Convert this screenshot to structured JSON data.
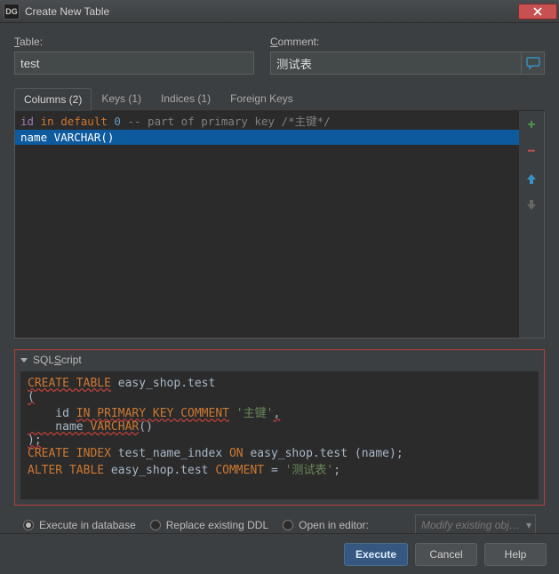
{
  "window": {
    "title": "Create New Table"
  },
  "labels": {
    "table": "Table:",
    "table_u": "T",
    "comment": "Comment:",
    "comment_u": "C",
    "sql_header": "SQL Script",
    "sql_u": "S"
  },
  "fields": {
    "table_value": "test",
    "comment_value": "测试表"
  },
  "tabs": {
    "columns": "Columns (2)",
    "keys": "Keys (1)",
    "indices": "Indices (1)",
    "fkeys": "Foreign Keys"
  },
  "cols": {
    "line1": {
      "name": "id",
      "type": "in",
      "def": "default",
      "val": "0",
      "cmt": "-- part of primary key /*主键*/"
    },
    "line2": {
      "name": "name",
      "type": "VARCHAR",
      "par": "()"
    }
  },
  "sql": {
    "l1": "CREATE TABLE",
    "l1b": " easy_shop.test",
    "l2": "(",
    "l3a": "    id ",
    "l3b": "IN PRIMARY KEY COMMENT",
    "l3c": " '主键'",
    "l3d": ",",
    "l4a": "    name ",
    "l4b": "VARCHAR",
    "l4c": "()",
    "l5": ");",
    "l6a": "CREATE INDEX",
    "l6b": " test_name_index ",
    "l6c": "ON",
    "l6d": " easy_shop.test (",
    "l6e": "name",
    "l6f": ");",
    "l7a": "ALTER TABLE",
    "l7b": " easy_shop.test ",
    "l7c": "COMMENT",
    "l7d": " = ",
    "l7e": "'测试表'",
    "l7f": ";"
  },
  "options": {
    "exec_db": "Execute in database",
    "replace": "Replace existing DDL",
    "open": "Open in editor:",
    "combo": "Modify existing obj…"
  },
  "buttons": {
    "execute": "Execute",
    "cancel": "Cancel",
    "help": "Help"
  }
}
